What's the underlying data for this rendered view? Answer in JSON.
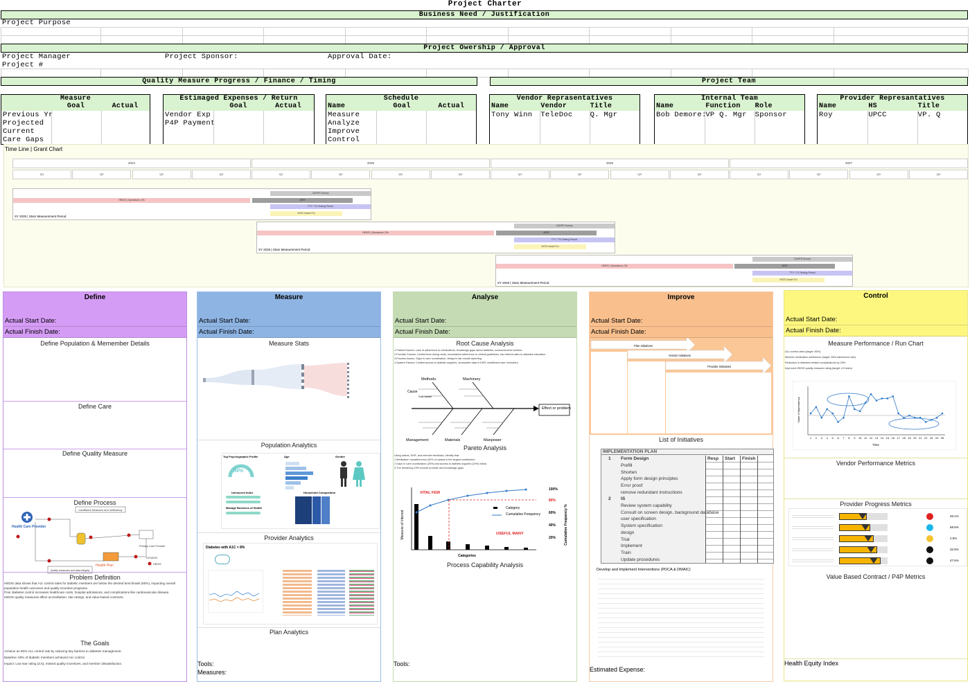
{
  "charter": {
    "title": "Project Charter",
    "business_need": "Business Need / Justification",
    "purpose_label": "Project Purpose",
    "ownership": "Project Owership / Approval",
    "manager_label": "Project Manager",
    "sponsor_label": "Project Sponsor:",
    "approval_label": "Approval Date:",
    "number_label": "Project #",
    "quality_band": "Quality Measure Progress / Finance / Timing",
    "team_band": "Project Team"
  },
  "measure_box": {
    "title": "Measure",
    "goal": "Goal",
    "actual": "Actual",
    "rows": [
      "Previous Yr",
      "Projected",
      "Current",
      "Care Gaps"
    ]
  },
  "expense_box": {
    "title": "Estimaged Expenses / Return",
    "goal": "Goal",
    "actual": "Actual",
    "rows": [
      "Vendor Exp",
      "P4P Payment"
    ]
  },
  "schedule_box": {
    "title": "Schedule",
    "name": "Name",
    "goal": "Goal",
    "actual": "Actual",
    "rows": [
      "Measure",
      "Analyze",
      "Improve",
      "Control"
    ]
  },
  "vendor_box": {
    "title": "Vendor Reprasentatives",
    "c1": "Name",
    "c2": "Vendor",
    "c3": "Title",
    "r1": "Tony Winn",
    "r2": "TeleDoc",
    "r3": "Q. Mgr"
  },
  "internal_box": {
    "title": "Internal Team",
    "c1": "Name",
    "c2": "Function",
    "c3": "Role",
    "r1": "Bob Demore:",
    "r2": "VP Q. Mgr",
    "r3": "Sponsor"
  },
  "provider_box": {
    "title": "Provider Represantatives",
    "c1": "Name",
    "c2": "HS",
    "c3": "Title",
    "r1": "Roy",
    "r2": "UPCC",
    "r3": "VP. Q"
  },
  "timeline": {
    "label": "Time Line | Grant Chart",
    "years": [
      "2024",
      "2025",
      "2026",
      "2027"
    ],
    "quarters": [
      "Q1",
      "Q2",
      "Q3",
      "Q4"
    ],
    "bars": {
      "caps": "CAHPS Survey",
      "hedis": "HEDIS | Operations | Rx",
      "mrr": "MRR",
      "tty": "TTY / TU Testing Period",
      "hos": "HOS Cohort F/u",
      "sy": "SY 2026 | Stars Measurement Period"
    }
  },
  "phases": {
    "define": {
      "title": "Define",
      "start": "Actual Start Date:",
      "finish": "Actual Finish Date:",
      "s1": "Define Population & Memember Details",
      "s2": "Define Care",
      "s3": "Define Quality Measure",
      "s4": "Define Process",
      "s5": "Problem Definition",
      "s6": "The Goals",
      "problem": [
        "HEDIS data shows that A1c control rates for diabetic members are below the desired benchmark (60%), impacting overall population health outcomes and quality incentive programs.",
        "Poor diabetes control increases healthcare costs, hospital admissions, and complications like cardiovascular disease.",
        "HEDIS quality measures affect accreditation, star ratings, and value-based contracts."
      ],
      "goals": [
        "Achieve an 80% A1c control rate by reducing key barriers to diabetes management.",
        "Baseline: 60% of diabetic members achieved A1c control.",
        "Impact: Low star rating (3.5), missed quality incentives, and member dissatisfaction."
      ],
      "process": {
        "top": "Insufficient Measures and Inefficiency",
        "provider": "Health Care Provider",
        "plan": "Health Plan",
        "pcp": "Primary Care Provider",
        "hedis": "HEDIS",
        "nysdoh": "NYSDOH",
        "quality": "Quality measures and data integrity"
      }
    },
    "measure": {
      "title": "Measure",
      "start": "Actual Start Date:",
      "finish": "Actual Finish Date:",
      "s1": "Measure Stats",
      "s2": "Population Analytics",
      "s3": "Provider Analytics",
      "s4": "Plan Analytics",
      "tools": "Tools:",
      "measures": "Measures:",
      "pop_title": "Top Psychographic Profile",
      "pop_age": "Age",
      "pop_gender": "Gender",
      "pop_pct": "34%",
      "uninsured": "Uninsured Index",
      "household": "Household Composition",
      "manage": "Manage Business of Health",
      "diab": "Diabetes with A1C < 8%"
    },
    "analyse": {
      "title": "Analyse",
      "start": "Actual Start Date:",
      "finish": "Actual Finish Date:",
      "s1": "Root Cause Analysis",
      "s2": "Pareto Analysis",
      "s3": "Process Capability Analysis",
      "tools": "Tools:",
      "rca_text": [
        "1.Patient Factors: Lack of adherence to medications, knowledge gaps about diabetes, socioeconomic barriers.",
        "2.Provider Factors: Limited time during visits, inconsistent adherence to clinical guidelines, low referral rates to diabetes education.",
        "3.Process Issues: Gaps in care coordination, delays in lab results reporting.",
        "4.System Factors: Limited access to diabetic supplies, incomplete data in EHR, insufficient care reminders."
      ],
      "fish": {
        "methods": "Methods",
        "machinery": "Machinery",
        "cause": "Cause",
        "subcause": "Sub-cause",
        "management": "Management",
        "materials": "Materials",
        "manpower": "Manpower",
        "effect": "Effect or problem"
      },
      "pareto_text": [
        "Using claims, EHR, and member feedback, identify that:",
        "1.Medication nonadherence (40% of cases) is the largest contribution",
        "2.Gaps in care coordination (25%) and access to diabetic supplies (20%) follow.",
        "3.The remaining 15% include provider and knowledge gaps."
      ],
      "pareto": {
        "vital": "VITAL FEW",
        "useful": "USEFUL MANY",
        "category": "Category",
        "cum": "Cumulative Frequency",
        "ylabel": "Measure of interest",
        "y2label": "Cumulative Frequency %",
        "xlabel": "Categories",
        "ticks": [
          "100%",
          "80%",
          "60%",
          "40%",
          "20%"
        ]
      }
    },
    "improve": {
      "title": "Improve",
      "start": "Actual Start Date:",
      "finish": "Actual Finish Date:",
      "arrows": [
        "Plan Initiatives",
        "Vendor Initiatives",
        "Provider Initiatives"
      ],
      "s1": "List of Initiatives",
      "s2": "Develop and Implement Interventions (PDCA & DMAIC)",
      "expense": "Estimated Expense:",
      "impl": {
        "title": "IMPLEMENTATION PLAN",
        "resp": "Resp",
        "start": "Start",
        "finish": "Finish",
        "n1": "1",
        "g1": "Form Design",
        "items1": [
          "Prefill",
          "Shorten",
          "Apply form design principles",
          "Error proof",
          "remove redundant instructions"
        ],
        "n2": "2",
        "g2": "IS",
        "items2": [
          "Review system capability",
          "Consult on screen design, background database",
          "user specification",
          "System specification",
          "design",
          "Trial",
          "Implement",
          "Train",
          "Update procedures"
        ]
      }
    },
    "control": {
      "title": "Control",
      "start": "Actual Start Date:",
      "finish": "Actual Finish Date:",
      "s1": "Measure Performance / Run Chart",
      "s2": "Vendor Performance Metrics",
      "s3": "Provider Progress Metrics",
      "s4": "Value Based Contract / P4P Metrics",
      "s5": "Health Equity Index",
      "perf_text": [
        "A1c control rates (target: 80%)",
        "Member medication adherence (target: 85% adherence rate).",
        "Reduction in diabetes-related complications by 15%.",
        "Improved HEDIS quality measure rating (target: 4.5 stars)"
      ],
      "run": {
        "ylabel": "Value of dependency",
        "xlabel": "Time",
        "ticks": [
          "1",
          "2",
          "3",
          "4",
          "5",
          "6",
          "7",
          "8",
          "9",
          "10",
          "11",
          "12",
          "13",
          "14",
          "15",
          "16",
          "17",
          "18",
          "19",
          "20",
          "21",
          "22",
          "23",
          "24",
          "25"
        ],
        "values": [
          10,
          13,
          8,
          12,
          10,
          6,
          8,
          18,
          12,
          11,
          15,
          19,
          16,
          17,
          17,
          18,
          10,
          8,
          9,
          8,
          8,
          6,
          7,
          8,
          10
        ]
      },
      "metric_vals": [
        "45.1%",
        "68.5%",
        "2.5%",
        "32.5%",
        "47.6%"
      ]
    }
  }
}
